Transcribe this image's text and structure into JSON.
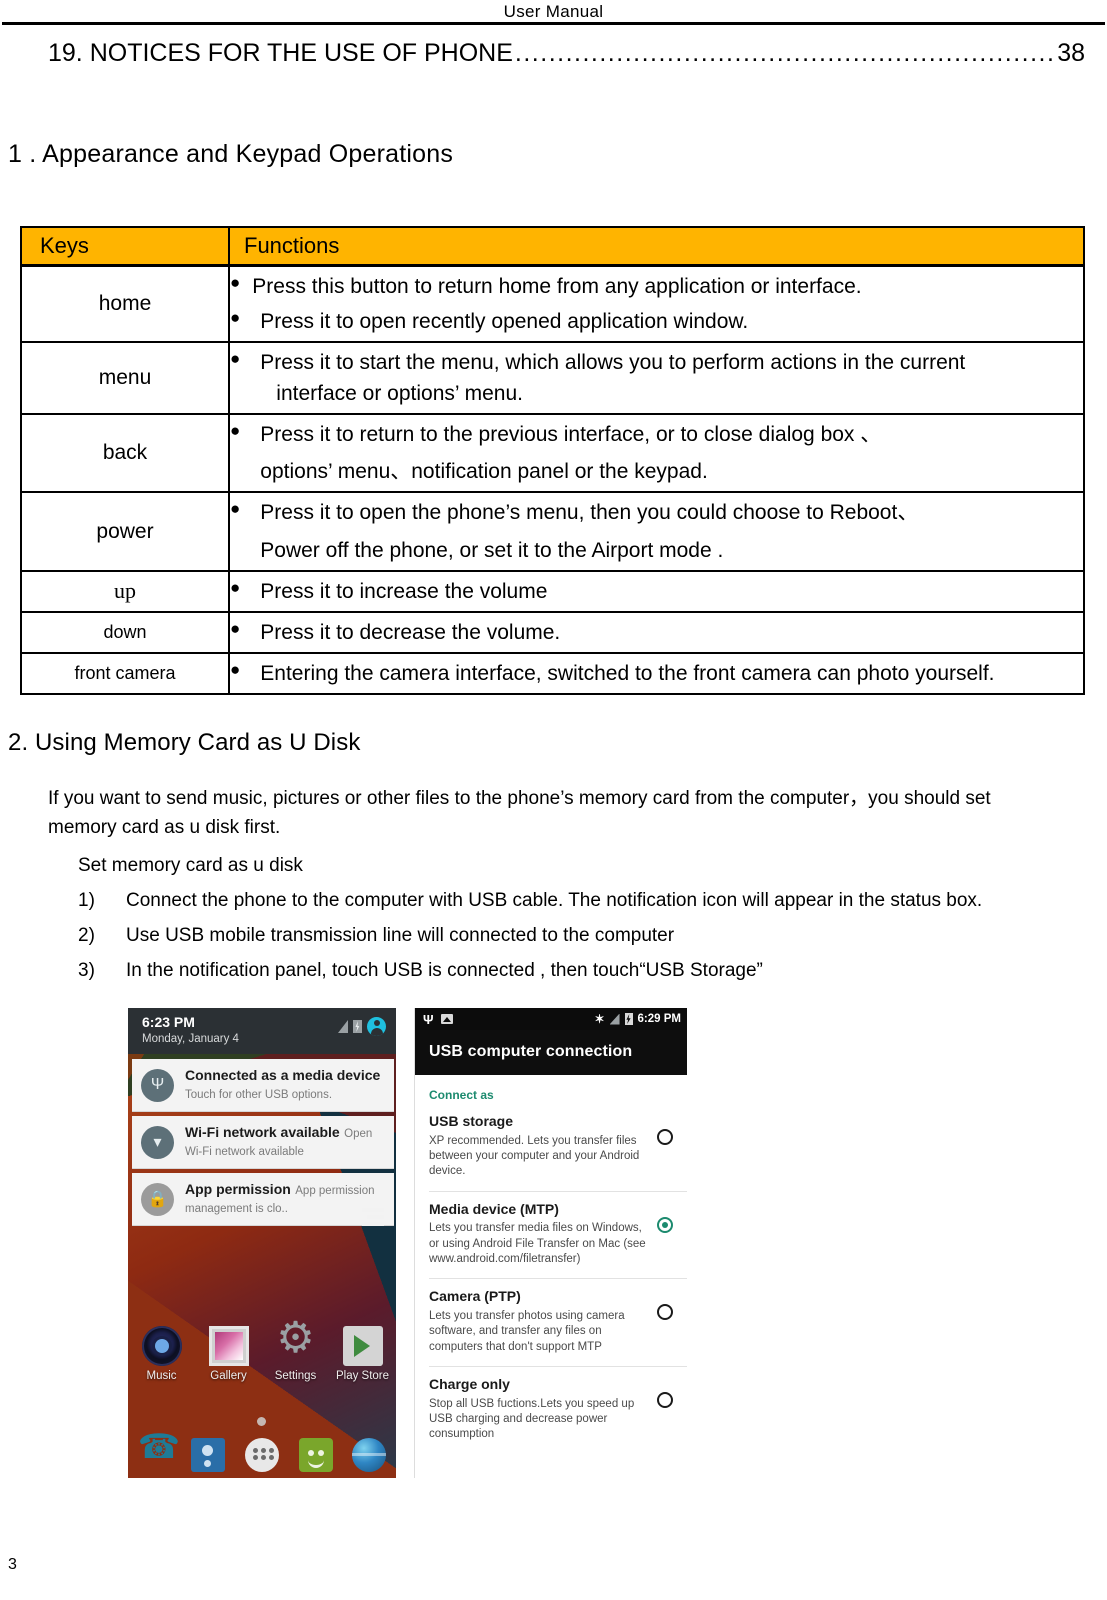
{
  "header": {
    "running_title": "User   Manual"
  },
  "toc": {
    "entry_label": "19. NOTICES FOR THE USE OF PHONE",
    "leader": "..........................................................................",
    "page": "38"
  },
  "sections": {
    "section1_title": "1 . Appearance and Keypad Operations",
    "section2_title": "2. Using Memory Card as U Disk"
  },
  "keys_table": {
    "headers": {
      "keys": "Keys",
      "functions": "Functions"
    },
    "rows": [
      {
        "key": "home",
        "items": [
          {
            "line1": "Press this button to return home from any application or interface.",
            "line2": ""
          },
          {
            "line1": "Press it to open recently opened application window.",
            "line2": ""
          }
        ]
      },
      {
        "key": "menu",
        "items": [
          {
            "line1": "Press it to start the menu, which allows you to perform actions in the current",
            "line2": "interface or options’ menu."
          }
        ]
      },
      {
        "key": "back",
        "items": [
          {
            "line1": "Press it to return to the previous interface, or to close dialog box 、",
            "line2": "options’ menu、notification panel or the keypad."
          }
        ]
      },
      {
        "key": "power",
        "items": [
          {
            "line1": "Press it to open the phone’s menu, then you could choose to Reboot、",
            "line2": "Power off the phone, or set it to the Airport mode ."
          }
        ]
      },
      {
        "key": "up",
        "items": [
          {
            "line1": "Press it to increase the volume",
            "line2": ""
          }
        ]
      },
      {
        "key": "down",
        "items": [
          {
            "line1": "Press it to decrease the volume.",
            "line2": ""
          }
        ]
      },
      {
        "key": "front camera",
        "items": [
          {
            "line1": "Entering the camera interface, switched to the front camera can photo yourself.",
            "line2": ""
          }
        ]
      }
    ]
  },
  "udisk": {
    "intro": "If you want to send music, pictures or other files to the phone’s memory card from the computer，you should set memory card as u disk first.",
    "subheading": "Set memory card as u disk",
    "steps": [
      {
        "index": "1)",
        "text": "Connect the phone to the computer with USB cable. The notification icon will appear in the status box."
      },
      {
        "index": "2)",
        "text": "Use USB mobile transmission line will connected to the computer"
      },
      {
        "index": "3)",
        "text": "In the notification panel, touch USB is connected , then touch“USB Storage”"
      }
    ]
  },
  "screenshot_left": {
    "status": {
      "time": "6:23 PM",
      "date": "Monday, January 4"
    },
    "notifications": [
      {
        "title": "Connected as a media device",
        "subtitle": "Touch for other USB options.",
        "icon": "usb-icon"
      },
      {
        "title": "Wi-Fi network available",
        "subtitle": "Open Wi-Fi network available",
        "icon": "wifi-icon"
      },
      {
        "title": "App permission",
        "subtitle": "App permission management is clo..",
        "icon": "lock-icon"
      }
    ],
    "apps": [
      {
        "label": "Music",
        "icon": "music-icon"
      },
      {
        "label": "Gallery",
        "icon": "gallery-icon"
      },
      {
        "label": "Settings",
        "icon": "gear-icon"
      },
      {
        "label": "Play Store",
        "icon": "play-store-icon"
      }
    ],
    "dock": [
      {
        "icon": "phone-icon"
      },
      {
        "icon": "contacts-icon"
      },
      {
        "icon": "app-drawer-icon"
      },
      {
        "icon": "messaging-icon"
      },
      {
        "icon": "browser-icon"
      }
    ]
  },
  "screenshot_right": {
    "status": {
      "time": "6:29 PM"
    },
    "title": "USB computer connection",
    "group_label": "Connect as",
    "options": [
      {
        "title": "USB storage",
        "desc": "XP recommended. Lets you transfer files between your computer and your Android device.",
        "selected": false
      },
      {
        "title": "Media device (MTP)",
        "desc": "Lets you transfer media files on Windows, or using Android File Transfer on Mac (see www.android.com/filetransfer)",
        "selected": true
      },
      {
        "title": "Camera (PTP)",
        "desc": "Lets you transfer photos using camera software, and transfer any files on computers that don't support MTP",
        "selected": false
      },
      {
        "title": "Charge only",
        "desc": "Stop all USB fuctions.Lets you speed up USB charging and decrease power consumption",
        "selected": false
      }
    ]
  },
  "footer": {
    "page_number": "3"
  },
  "colors": {
    "table_header": "#FFB400",
    "accent_green": "#1c8a6e",
    "avatar_cyan": "#1fc0df"
  }
}
